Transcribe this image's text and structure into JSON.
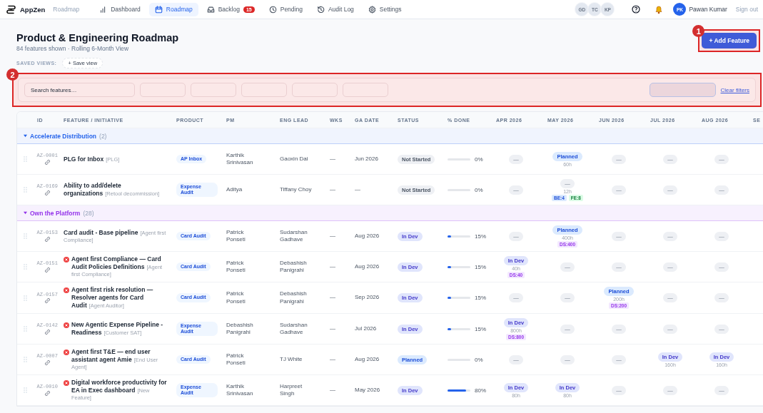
{
  "nav": {
    "brand": "AppZen",
    "product": "Roadmap",
    "tabs": [
      {
        "label": "Dashboard",
        "kind": "dashboard",
        "selected": false
      },
      {
        "label": "Roadmap",
        "kind": "calendar",
        "selected": true
      },
      {
        "label": "Backlog",
        "kind": "inbox",
        "selected": false,
        "badge": "15"
      },
      {
        "label": "Pending",
        "kind": "clock",
        "selected": false
      },
      {
        "label": "Audit Log",
        "kind": "history",
        "selected": false
      },
      {
        "label": "Settings",
        "kind": "settings",
        "selected": false
      }
    ],
    "presence": [
      "GD",
      "TC",
      "KP"
    ],
    "user": {
      "initials": "PK",
      "name": "Pawan Kumar"
    },
    "sign_out": "Sign out"
  },
  "header": {
    "title": "Product & Engineering Roadmap",
    "subtitle": "84 features shown · Rolling 6-Month View",
    "add_button": {
      "label": "+ Add Feature",
      "callout": "1"
    },
    "saved_views": {
      "label": "SAVED VIEWS:",
      "button": "+ Save view"
    }
  },
  "filters": {
    "callout": "2",
    "search": {
      "placeholder": "Search features…"
    },
    "dropdowns": [
      {
        "kind": "plain"
      },
      {
        "kind": "plain"
      },
      {
        "kind": "plain"
      },
      {
        "kind": "plain"
      },
      {
        "kind": "plain"
      },
      {
        "kind": "shaded"
      }
    ],
    "clear_link": "Clear filters"
  },
  "table": {
    "columns": [
      "ID",
      "FEATURE / INITIATIVE",
      "PRODUCT",
      "PM",
      "ENG LEAD",
      "WKS",
      "GA DATE",
      "STATUS",
      "% DONE",
      "APR 2026",
      "MAY 2026",
      "JUN 2026",
      "JUL 2026",
      "AUG 2026",
      "SE"
    ],
    "groups": [
      {
        "name": "Accelerate Distribution",
        "count": "(2)",
        "color": "#2563eb",
        "expanded": true,
        "rows": [
          {
            "id": "AZ-0001",
            "title": "PLG for Inbox",
            "tag": "[PLG]",
            "alert": false,
            "product": "AP Inbox",
            "pm": "Karthik Srinivasan",
            "eng_lead": "Gaoxin Dai",
            "wks": "—",
            "ga_date": "Jun 2026",
            "status": {
              "label": "Not Started",
              "kind": "not_started"
            },
            "done": {
              "level": 0,
              "reading": "0%"
            },
            "months": [
              {
                "label": "—",
                "kind": "empty"
              },
              {
                "label": "Planned",
                "kind": "planned",
                "hours": "60h"
              },
              {
                "label": "—",
                "kind": "empty"
              },
              {
                "label": "—",
                "kind": "empty"
              },
              {
                "label": "—",
                "kind": "empty"
              }
            ]
          },
          {
            "id": "AZ-0169",
            "title": "Ability to add/delete organizations",
            "tag": "[Retool decommission]",
            "alert": false,
            "product": "Expense Audit",
            "pm": "Aditya",
            "eng_lead": "Tiffany Choy",
            "wks": "—",
            "ga_date": "—",
            "status": {
              "label": "Not Started",
              "kind": "not_started"
            },
            "done": {
              "level": 0,
              "reading": "0%"
            },
            "months": [
              {
                "label": "—",
                "kind": "empty"
              },
              {
                "label": "—",
                "kind": "empty",
                "hours": "12h",
                "chips": [
                  {
                    "label": "BE:4",
                    "kind": "be"
                  },
                  {
                    "label": "FE:8",
                    "kind": "fe"
                  }
                ]
              },
              {
                "label": "—",
                "kind": "empty"
              },
              {
                "label": "—",
                "kind": "empty"
              },
              {
                "label": "—",
                "kind": "empty"
              }
            ]
          }
        ]
      },
      {
        "name": "Own the Platform",
        "count": "(28)",
        "color": "#9333ea",
        "expanded": true,
        "rows": [
          {
            "id": "AZ-0153",
            "title": "Card audit - Base pipeline",
            "tag": "[Agent first Compliance]",
            "alert": false,
            "product": "Card Audit",
            "pm": "Patrick Ponseti",
            "eng_lead": "Sudarshan Gadhave",
            "wks": "—",
            "ga_date": "Aug 2026",
            "status": {
              "label": "In Dev",
              "kind": "in_dev"
            },
            "done": {
              "level": 0.15,
              "reading": "15%"
            },
            "months": [
              {
                "label": "—",
                "kind": "empty"
              },
              {
                "label": "Planned",
                "kind": "planned",
                "hours": "400h",
                "chips": [
                  {
                    "label": "DS:400",
                    "kind": "ds"
                  }
                ]
              },
              {
                "label": "—",
                "kind": "empty"
              },
              {
                "label": "—",
                "kind": "empty"
              },
              {
                "label": "—",
                "kind": "empty"
              }
            ]
          },
          {
            "id": "AZ-0151",
            "title": "Agent first Compliance — Card Audit Policies Definitions",
            "tag": "[Agent first Compliance]",
            "alert": true,
            "product": "Card Audit",
            "pm": "Patrick Ponseti",
            "eng_lead": "Debashish Panigrahi",
            "wks": "—",
            "ga_date": "Aug 2026",
            "status": {
              "label": "In Dev",
              "kind": "in_dev"
            },
            "done": {
              "level": 0.15,
              "reading": "15%"
            },
            "months": [
              {
                "label": "In Dev",
                "kind": "in_dev",
                "hours": "40h",
                "chips": [
                  {
                    "label": "DS:40",
                    "kind": "ds"
                  }
                ]
              },
              {
                "label": "—",
                "kind": "empty"
              },
              {
                "label": "—",
                "kind": "empty"
              },
              {
                "label": "—",
                "kind": "empty"
              },
              {
                "label": "—",
                "kind": "empty"
              }
            ]
          },
          {
            "id": "AZ-0157",
            "title": "Agent first risk resolution — Resolver agents for Card Audit",
            "tag": "[Agent Auditor]",
            "alert": true,
            "product": "Card Audit",
            "pm": "Patrick Ponseti",
            "eng_lead": "Debashish Panigrahi",
            "wks": "—",
            "ga_date": "Sep 2026",
            "status": {
              "label": "In Dev",
              "kind": "in_dev"
            },
            "done": {
              "level": 0.15,
              "reading": "15%"
            },
            "months": [
              {
                "label": "—",
                "kind": "empty"
              },
              {
                "label": "—",
                "kind": "empty"
              },
              {
                "label": "Planned",
                "kind": "planned",
                "hours": "200h",
                "chips": [
                  {
                    "label": "DS:200",
                    "kind": "ds"
                  }
                ]
              },
              {
                "label": "—",
                "kind": "empty"
              },
              {
                "label": "—",
                "kind": "empty"
              }
            ]
          },
          {
            "id": "AZ-0142",
            "title": "New Agentic Expense Pipeline - Readiness",
            "tag": "[Customer SAT]",
            "alert": true,
            "product": "Expense Audit",
            "pm": "Debashish Panigrahi",
            "eng_lead": "Sudarshan Gadhave",
            "wks": "—",
            "ga_date": "Jul 2026",
            "status": {
              "label": "In Dev",
              "kind": "in_dev"
            },
            "done": {
              "level": 0.15,
              "reading": "15%"
            },
            "months": [
              {
                "label": "In Dev",
                "kind": "in_dev",
                "hours": "800h",
                "chips": [
                  {
                    "label": "DS:800",
                    "kind": "ds"
                  }
                ]
              },
              {
                "label": "—",
                "kind": "empty"
              },
              {
                "label": "—",
                "kind": "empty"
              },
              {
                "label": "—",
                "kind": "empty"
              },
              {
                "label": "—",
                "kind": "empty"
              }
            ]
          },
          {
            "id": "AZ-0007",
            "title": "Agent first T&E — end user assistant agent Amie",
            "tag": "[End User Agent]",
            "alert": true,
            "product": "Card Audit",
            "pm": "Patrick Ponseti",
            "eng_lead": "TJ White",
            "wks": "—",
            "ga_date": "Aug 2026",
            "status": {
              "label": "Planned",
              "kind": "planned"
            },
            "done": {
              "level": 0,
              "reading": "0%"
            },
            "months": [
              {
                "label": "—",
                "kind": "empty"
              },
              {
                "label": "—",
                "kind": "empty"
              },
              {
                "label": "—",
                "kind": "empty"
              },
              {
                "label": "In Dev",
                "kind": "in_dev",
                "hours": "160h"
              },
              {
                "label": "In Dev",
                "kind": "in_dev",
                "hours": "160h"
              }
            ]
          },
          {
            "id": "AZ-0010",
            "title": "Digital workforce productivity for EA in Exec dashboard",
            "tag": "[New Feature]",
            "alert": true,
            "product": "Expense Audit",
            "pm": "Karthik Srinivasan",
            "eng_lead": "Harpreet Singh",
            "wks": "—",
            "ga_date": "May 2026",
            "status": {
              "label": "In Dev",
              "kind": "in_dev"
            },
            "done": {
              "level": 0.8,
              "reading": "80%"
            },
            "months": [
              {
                "label": "In Dev",
                "kind": "in_dev",
                "hours": "80h"
              },
              {
                "label": "In Dev",
                "kind": "in_dev",
                "hours": "80h"
              },
              {
                "label": "—",
                "kind": "empty"
              },
              {
                "label": "—",
                "kind": "empty"
              },
              {
                "label": "—",
                "kind": "empty"
              }
            ]
          }
        ]
      }
    ]
  }
}
